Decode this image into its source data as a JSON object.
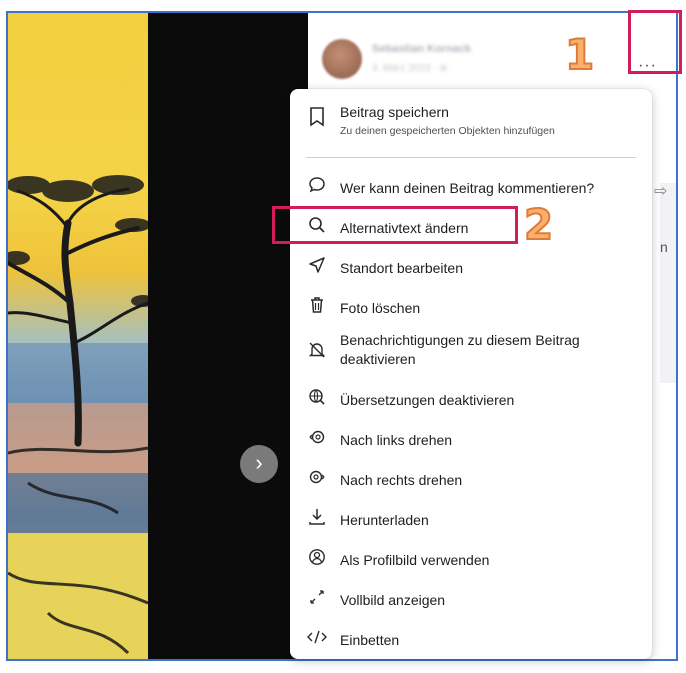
{
  "post": {
    "author_name": "Sebastian Kornack",
    "author_meta": "3. März 2023 · ⊕",
    "more_label": "···"
  },
  "navigation": {
    "next_label": "›"
  },
  "menu": {
    "items": [
      {
        "label": "Beitrag speichern",
        "sub": "Zu deinen gespeicherten Objekten hinzufügen",
        "icon": "bookmark-icon"
      },
      {
        "label": "Wer kann deinen Beitrag kommentieren?",
        "icon": "comment-icon"
      },
      {
        "label": "Alternativtext ändern",
        "icon": "search-icon"
      },
      {
        "label": "Standort bearbeiten",
        "icon": "location-arrow-icon"
      },
      {
        "label": "Foto löschen",
        "icon": "trash-icon"
      },
      {
        "label": "Benachrichtigungen zu diesem Beitrag",
        "label2": "deaktivieren",
        "icon": "bell-off-icon"
      },
      {
        "label": "Übersetzungen deaktivieren",
        "icon": "globe-icon"
      },
      {
        "label": "Nach links drehen",
        "icon": "rotate-left-icon"
      },
      {
        "label": "Nach rechts drehen",
        "icon": "rotate-right-icon"
      },
      {
        "label": "Herunterladen",
        "icon": "download-icon"
      },
      {
        "label": "Als Profilbild verwenden",
        "icon": "profile-icon"
      },
      {
        "label": "Vollbild anzeigen",
        "icon": "fullscreen-icon"
      },
      {
        "label": "Einbetten",
        "icon": "embed-icon"
      }
    ]
  },
  "annotations": {
    "step1": "1",
    "step2": "2"
  },
  "colors": {
    "annotation_box": "#d21d5b",
    "annotation_number": "#f7b16b",
    "frame_border": "#3d73c9"
  }
}
